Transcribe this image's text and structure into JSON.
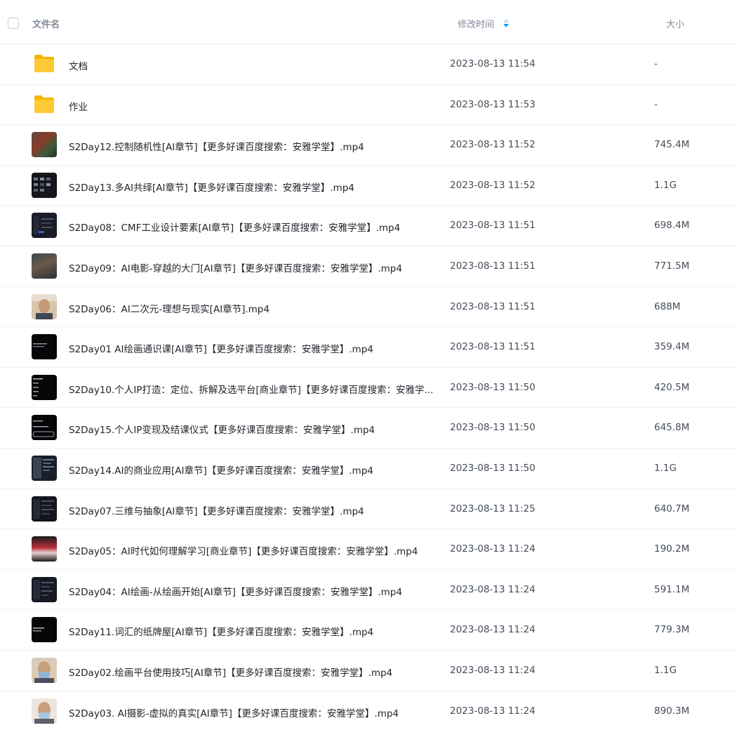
{
  "header": {
    "name_label": "文件名",
    "time_label": "修改时间",
    "size_label": "大小"
  },
  "files": [
    {
      "name": "文档",
      "time": "2023-08-13 11:54",
      "size": "-",
      "icon": "folder-icon"
    },
    {
      "name": "作业",
      "time": "2023-08-13 11:53",
      "size": "-",
      "icon": "folder-icon"
    },
    {
      "name": "S2Day12.控制随机性[AI章节]【更多好课百度搜索：安雅学堂】.mp4",
      "time": "2023-08-13 11:52",
      "size": "745.4M",
      "icon": "video-thumbnail"
    },
    {
      "name": "S2Day13.多AI共绎[AI章节]【更多好课百度搜索：安雅学堂】.mp4",
      "time": "2023-08-13 11:52",
      "size": "1.1G",
      "icon": "video-thumbnail"
    },
    {
      "name": "S2Day08：CMF工业设计要素[AI章节]【更多好课百度搜索：安雅学堂】.mp4",
      "time": "2023-08-13 11:51",
      "size": "698.4M",
      "icon": "video-thumbnail"
    },
    {
      "name": "S2Day09：AI电影-穿越的大门[AI章节]【更多好课百度搜索：安雅学堂】.mp4",
      "time": "2023-08-13 11:51",
      "size": "771.5M",
      "icon": "video-thumbnail"
    },
    {
      "name": "S2Day06：AI二次元-理想与现实[AI章节].mp4",
      "time": "2023-08-13 11:51",
      "size": "688M",
      "icon": "video-thumbnail"
    },
    {
      "name": "S2Day01 AI绘画通识课[AI章节]【更多好课百度搜索：安雅学堂】.mp4",
      "time": "2023-08-13 11:51",
      "size": "359.4M",
      "icon": "video-thumbnail"
    },
    {
      "name": "S2Day10.个人IP打造：定位、拆解及选平台[商业章节]【更多好课百度搜索：安雅学...",
      "time": "2023-08-13 11:50",
      "size": "420.5M",
      "icon": "video-thumbnail"
    },
    {
      "name": "S2Day15.个人IP变现及结课仪式【更多好课百度搜索：安雅学堂】.mp4",
      "time": "2023-08-13 11:50",
      "size": "645.8M",
      "icon": "video-thumbnail"
    },
    {
      "name": "S2Day14.AI的商业应用[AI章节]【更多好课百度搜索：安雅学堂】.mp4",
      "time": "2023-08-13 11:50",
      "size": "1.1G",
      "icon": "video-thumbnail"
    },
    {
      "name": "S2Day07.三维与抽象[AI章节]【更多好课百度搜索：安雅学堂】.mp4",
      "time": "2023-08-13 11:25",
      "size": "640.7M",
      "icon": "video-thumbnail"
    },
    {
      "name": "S2Day05：AI时代如何理解学习[商业章节]【更多好课百度搜索：安雅学堂】.mp4",
      "time": "2023-08-13 11:24",
      "size": "190.2M",
      "icon": "video-thumbnail"
    },
    {
      "name": "S2Day04：AI绘画-从绘画开始[AI章节]【更多好课百度搜索：安雅学堂】.mp4",
      "time": "2023-08-13 11:24",
      "size": "591.1M",
      "icon": "video-thumbnail"
    },
    {
      "name": "S2Day11.词汇的纸牌屋[AI章节]【更多好课百度搜索：安雅学堂】.mp4",
      "time": "2023-08-13 11:24",
      "size": "779.3M",
      "icon": "video-thumbnail"
    },
    {
      "name": "S2Day02.绘画平台使用技巧[AI章节]【更多好课百度搜索：安雅学堂】.mp4",
      "time": "2023-08-13 11:24",
      "size": "1.1G",
      "icon": "video-thumbnail"
    },
    {
      "name": "S2Day03. AI摄影-虚拟的真实[AI章节]【更多好课百度搜索：安雅学堂】.mp4",
      "time": "2023-08-13 11:24",
      "size": "890.3M",
      "icon": "video-thumbnail"
    }
  ],
  "colors": {
    "folder": "#ffc933",
    "sort_active": "#06a7ff",
    "sort_inactive": "#c4d8f0"
  }
}
